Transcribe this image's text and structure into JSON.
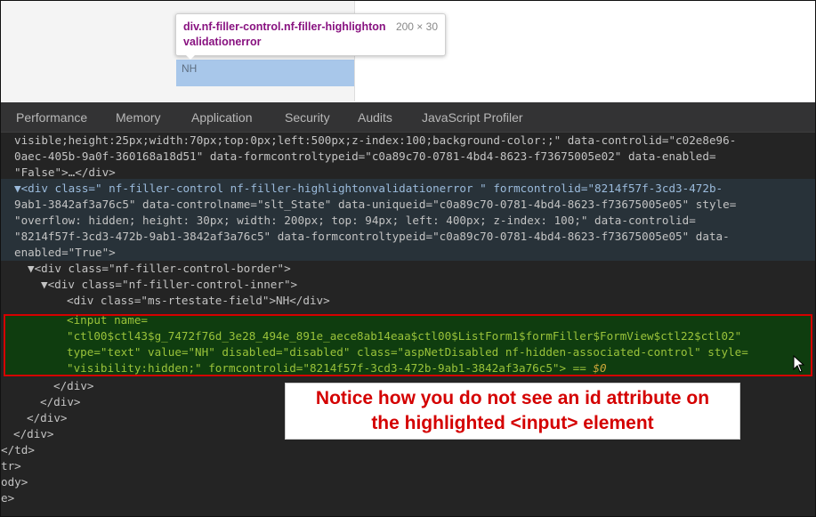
{
  "preview": {
    "tooltip_selector": "div.nf-filler-control.nf-filler-highlightonvalidationerror",
    "tooltip_size": "200 × 30",
    "element_text": "NH"
  },
  "tabs": [
    "Performance",
    "Memory",
    "Application",
    "Security",
    "Audits",
    "JavaScript Profiler"
  ],
  "code": {
    "l1": "visible;height:25px;width:70px;top:0px;left:500px;z-index:100;background-color:;\" data-controlid=\"c02e8e96-",
    "l2": "0aec-405b-9a0f-360168a18d51\" data-formcontroltypeid=\"c0a89c70-0781-4bd4-8623-f73675005e02\" data-enabled=",
    "l3": "\"False\">…</div>",
    "l4": "▼<div class=\" nf-filler-control nf-filler-highlightonvalidationerror \" formcontrolid=\"8214f57f-3cd3-472b-",
    "l5": "9ab1-3842af3a76c5\" data-controlname=\"slt_State\" data-uniqueid=\"c0a89c70-0781-4bd4-8623-f73675005e05\" style=",
    "l6": "\"overflow: hidden; height: 30px; width: 200px; top: 94px; left: 400px; z-index: 100;\" data-controlid=",
    "l7": "\"8214f57f-3cd3-472b-9ab1-3842af3a76c5\" data-formcontroltypeid=\"c0a89c70-0781-4bd4-8623-f73675005e05\" data-",
    "l8": "enabled=\"True\">",
    "l9": "▼<div class=\"nf-filler-control-border\">",
    "l10": "▼<div class=\"nf-filler-control-inner\">",
    "l11": "<div class=\"ms-rtestate-field\">NH</div>",
    "l12": "<input name=",
    "l13": "\"ctl00$ctl43$g_7472f76d_3e28_494e_891e_aece8ab14eaa$ctl00$ListForm1$formFiller$FormView$ctl22$ctl02\"",
    "l14": "type=\"text\" value=\"NH\" disabled=\"disabled\" class=\"aspNetDisabled nf-hidden-associated-control\" style=",
    "l15": "\"visibility:hidden;\" formcontrolid=\"8214f57f-3cd3-472b-9ab1-3842af3a76c5\"> == ",
    "l15_var": "$0",
    "l16": "</div>",
    "l17": "</div>",
    "l18": "</div>",
    "l19": "</div>",
    "l20": "</td>",
    "l21": "tr>",
    "l22": "ody>",
    "l23": "e>"
  },
  "callout": {
    "line1": "Notice how you do not see an id attribute on",
    "line2": "the highlighted <input> element"
  }
}
